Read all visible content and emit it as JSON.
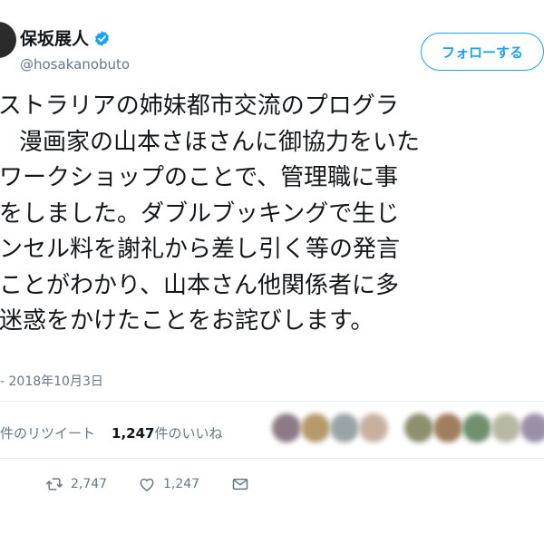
{
  "user": {
    "display_name": "保坂展人",
    "handle": "@hosakanobuto",
    "verified": true
  },
  "follow_button": {
    "label": "フォローする"
  },
  "tweet": {
    "lines": [
      "ーストラリアの姉妹都市交流のプログラ",
      "漫画家の山本さほさんに御協力をいた",
      "たワークショップのことで、管理職に事",
      "認をしました。ダブルブッキングで生じ",
      "ャンセル料を謝礼から差し引く等の発言",
      "たことがわかり、山本さん他関係者に多",
      "ご迷惑をかけたことをお詫びします。"
    ],
    "timestamp": "- 2018年10月3日"
  },
  "stats": {
    "retweets_suffix": "件のリツイート",
    "likes_count": "1,247",
    "likes_suffix": "件のいいね"
  },
  "actions": {
    "retweet_count": "2,747",
    "like_count": "1,247"
  },
  "icons": [
    "verified-badge-icon",
    "retweet-icon",
    "like-icon",
    "direct-message-icon"
  ],
  "colors": {
    "accent": "#1da1f2",
    "text": "#14171a",
    "muted": "#657786",
    "divider": "#e6ecf0"
  }
}
